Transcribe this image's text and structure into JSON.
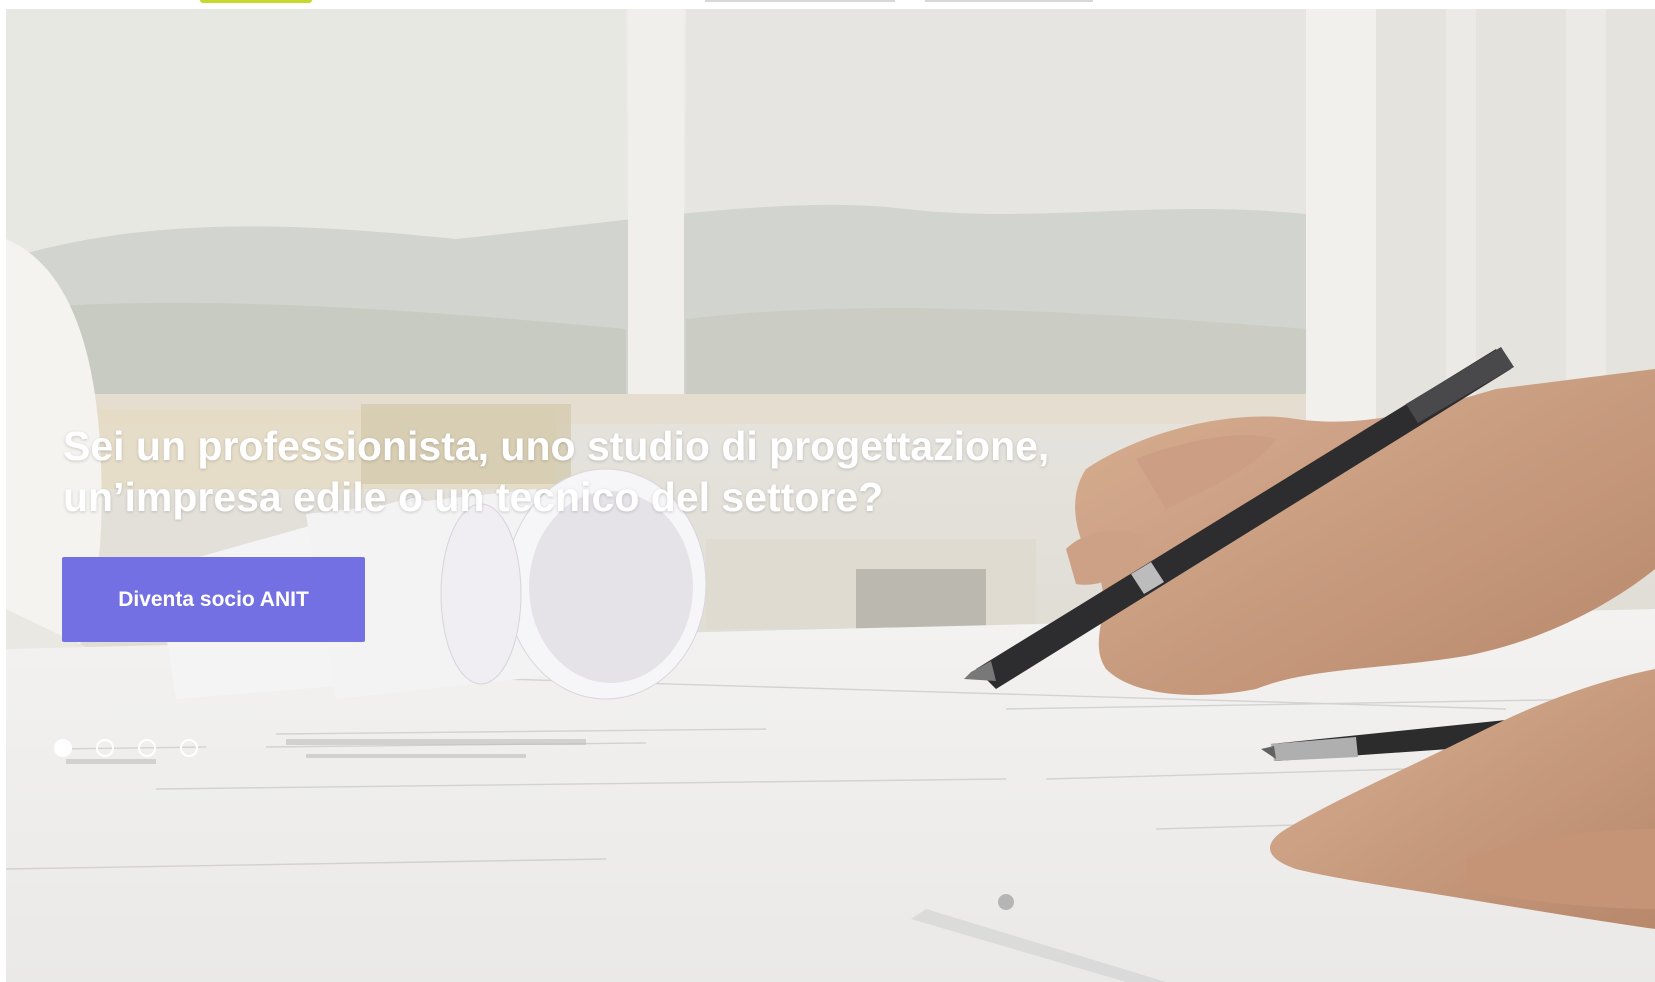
{
  "hero": {
    "title_line1": "Sei un professionista, uno studio di progettazione,",
    "title_line2": "un’impresa edile o un tecnico del settore?",
    "cta_label": "Diventa socio ANIT",
    "accent_color": "#7370e3",
    "slider": {
      "slide_count": 4,
      "active_index": 0
    },
    "background_image": "architect-hand-drawing-with-pen-on-blueprints-near-rolled-plans-and-helmet"
  },
  "header": {
    "logo_accent_color": "#c5d92d"
  }
}
